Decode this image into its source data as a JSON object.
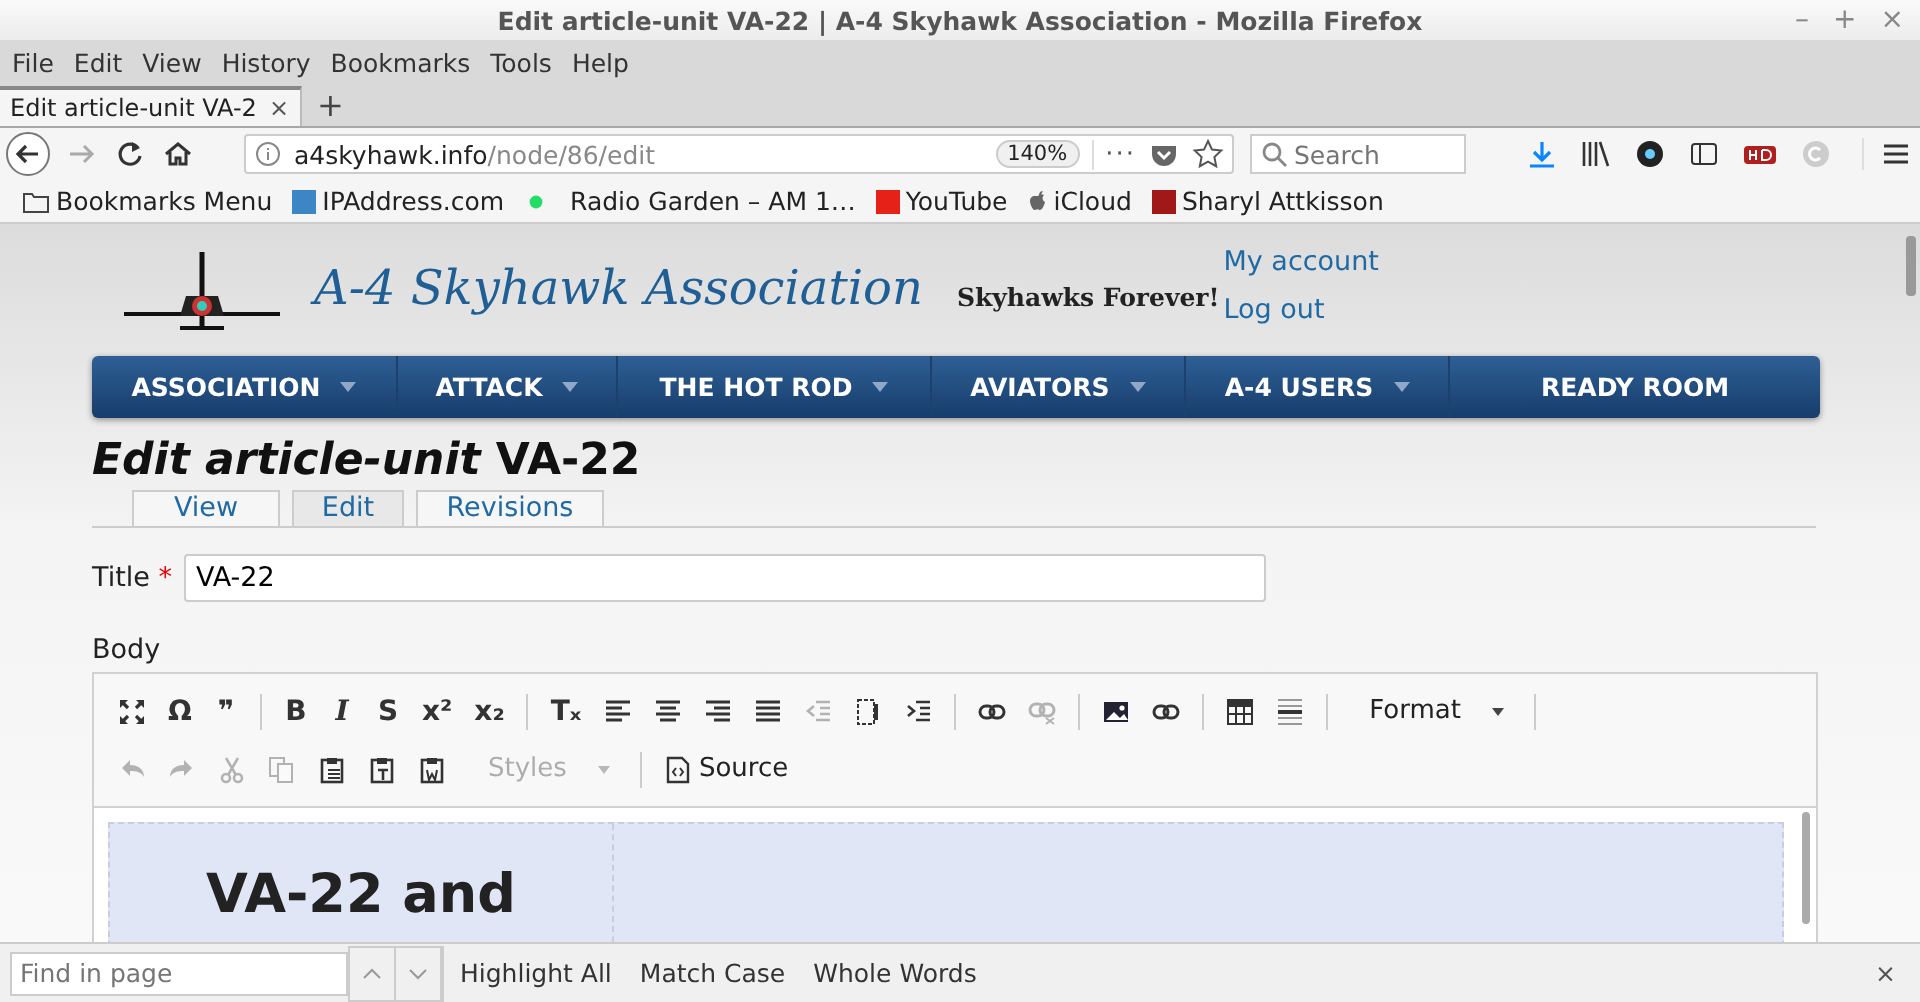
{
  "window": {
    "title": "Edit article-unit VA-22 | A-4 Skyhawk Association - Mozilla Firefox",
    "controls": [
      "–",
      "+",
      "×"
    ]
  },
  "menu_bar": [
    {
      "label": "File"
    },
    {
      "label": "Edit"
    },
    {
      "label": "View"
    },
    {
      "label": "History"
    },
    {
      "label": "Bookmarks"
    },
    {
      "label": "Tools"
    },
    {
      "label": "Help"
    }
  ],
  "tabs": [
    {
      "label": "Edit article-unit VA-2",
      "close": "×",
      "selected": true
    }
  ],
  "new_tab": "+",
  "address_bar": {
    "host": "a4skyhawk.info",
    "path": "/node/86/edit",
    "zoom": "140%",
    "more": "···"
  },
  "search": {
    "placeholder": "Search"
  },
  "bookmarks": [
    {
      "kind": "folder",
      "label": "Bookmarks Menu"
    },
    {
      "kind": "site",
      "label": "IPAddress.com",
      "color": "#3d86c6"
    },
    {
      "kind": "dot",
      "label": "Radio Garden – AM 1…",
      "color": "#22dd66"
    },
    {
      "kind": "site",
      "label": "YouTube",
      "color": "#e62117"
    },
    {
      "kind": "apple",
      "label": "iCloud"
    },
    {
      "kind": "site",
      "label": "Sharyl Attkisson",
      "color": "#a01818"
    }
  ],
  "site": {
    "name": "A-4 Skyhawk Association",
    "tagline": "Skyhawks Forever!",
    "user_links": [
      "My account",
      "Log out"
    ]
  },
  "nav": [
    {
      "label": "ASSOCIATION",
      "dropdown": true
    },
    {
      "label": "ATTACK",
      "dropdown": true
    },
    {
      "label": "THE HOT ROD",
      "dropdown": true
    },
    {
      "label": "AVIATORS",
      "dropdown": true
    },
    {
      "label": "A-4 USERS",
      "dropdown": true
    },
    {
      "label": "READY ROOM",
      "dropdown": false
    }
  ],
  "page_title": "*Edit article-unit* VA-22",
  "page_tabs": [
    {
      "label": "View",
      "selected": false
    },
    {
      "label": "Edit",
      "selected": true
    },
    {
      "label": "Revisions",
      "selected": false
    }
  ],
  "form": {
    "title_label": "Title",
    "required_mark": "*",
    "title_value": "VA-22",
    "body_label": "Body"
  },
  "editor": {
    "toolbar_rows": [
      [
        {
          "kind": "maximize",
          "disabled": false
        },
        {
          "kind": "glyph",
          "glyph": "Ω",
          "disabled": false
        },
        {
          "kind": "glyph",
          "glyph": "❞",
          "disabled": false
        },
        {
          "kind": "separator"
        },
        {
          "kind": "glyph",
          "glyph": "B",
          "disabled": false
        },
        {
          "kind": "glyph",
          "glyph": "I",
          "disabled": false
        },
        {
          "kind": "glyph",
          "glyph": "S",
          "disabled": false
        },
        {
          "kind": "glyph",
          "glyph": "x²",
          "disabled": false
        },
        {
          "kind": "glyph",
          "glyph": "x₂",
          "disabled": false
        },
        {
          "kind": "separator"
        },
        {
          "kind": "glyph",
          "glyph": "Tₓ",
          "disabled": false
        },
        {
          "kind": "align-left",
          "disabled": false
        },
        {
          "kind": "align-center",
          "disabled": false
        },
        {
          "kind": "align-right",
          "disabled": false
        },
        {
          "kind": "justify",
          "disabled": false
        },
        {
          "kind": "outdent",
          "disabled": true
        },
        {
          "kind": "blocks",
          "disabled": false
        },
        {
          "kind": "indent",
          "disabled": false
        },
        {
          "kind": "separator"
        },
        {
          "kind": "link",
          "disabled": false
        },
        {
          "kind": "unlink",
          "disabled": true
        },
        {
          "kind": "separator"
        },
        {
          "kind": "image",
          "disabled": false
        },
        {
          "kind": "link",
          "disabled": false
        },
        {
          "kind": "separator"
        },
        {
          "kind": "table",
          "disabled": false
        },
        {
          "kind": "rule",
          "disabled": false
        },
        {
          "kind": "separator"
        },
        {
          "kind": "dropdown",
          "label": "Format",
          "disabled": false
        },
        {
          "kind": "separator"
        }
      ],
      [
        {
          "kind": "undo",
          "disabled": true
        },
        {
          "kind": "redo",
          "disabled": true
        },
        {
          "kind": "cut",
          "disabled": true
        },
        {
          "kind": "copy",
          "disabled": true
        },
        {
          "kind": "paste",
          "disabled": false
        },
        {
          "kind": "paste-text",
          "disabled": false
        },
        {
          "kind": "paste-word",
          "disabled": false
        },
        {
          "kind": "dropdown",
          "label": "Styles",
          "disabled": true
        },
        {
          "kind": "separator"
        },
        {
          "kind": "source",
          "label": "Source",
          "disabled": false
        }
      ]
    ],
    "content_heading": "VA-22 and"
  },
  "find_bar": {
    "placeholder": "Find in page",
    "options": [
      {
        "label": "Highlight All"
      },
      {
        "label": "Match Case"
      },
      {
        "label": "Whole Words"
      }
    ],
    "close": "×"
  }
}
